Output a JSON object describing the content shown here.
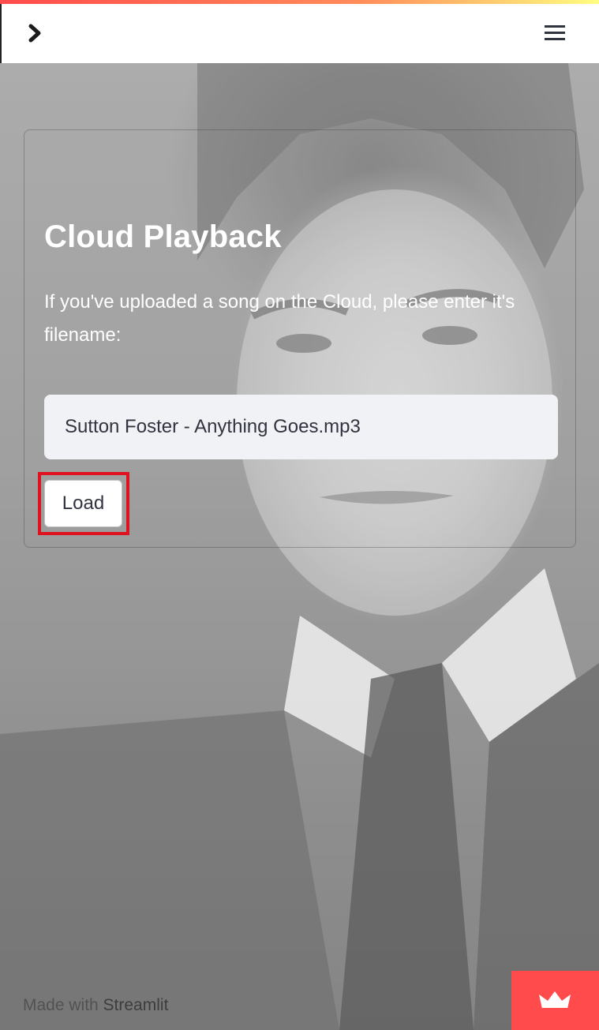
{
  "header": {
    "sidebar_toggle_icon": "chevron-right-icon",
    "menu_icon": "hamburger-menu-icon"
  },
  "main": {
    "title": "Cloud Playback",
    "prompt": "If you've uploaded a song on the Cloud, please enter it's filename:",
    "filename_input": {
      "value": "Sutton Foster - Anything Goes.mp3",
      "placeholder": ""
    },
    "load_button_label": "Load"
  },
  "footer": {
    "made_with": "Made with ",
    "link_text": "Streamlit"
  },
  "colors": {
    "accent": "#ff4b4b",
    "highlight": "#e0121f",
    "input_bg": "#f0f2f6",
    "text_dark": "#31333f"
  }
}
